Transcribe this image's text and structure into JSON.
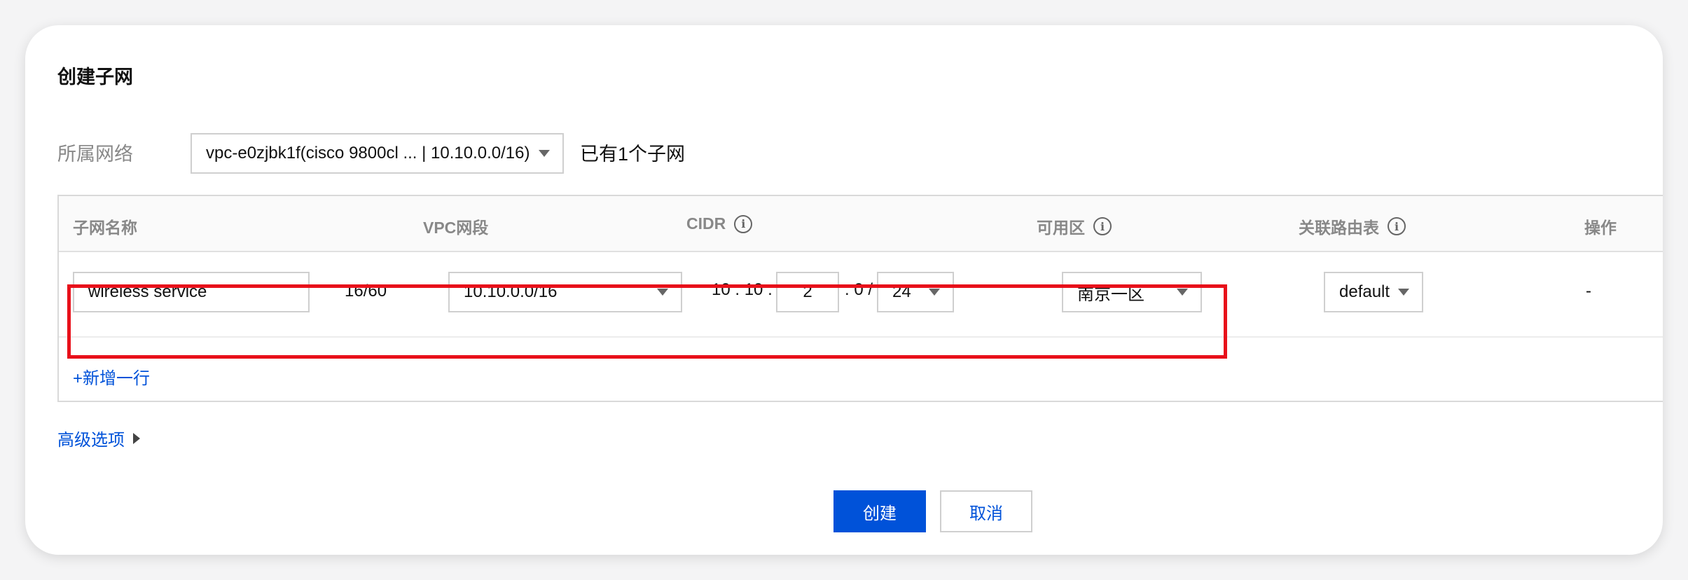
{
  "dialog": {
    "title": "创建子网"
  },
  "network": {
    "label": "所属网络",
    "selected": "vpc-e0zjbk1f(cisco 9800cl ... | 10.10.0.0/16)",
    "note": "已有1个子网"
  },
  "table": {
    "headers": {
      "name": "子网名称",
      "vpc": "VPC网段",
      "cidr": "CIDR",
      "zone": "可用区",
      "route": "关联路由表",
      "action": "操作"
    },
    "row": {
      "name_value": "wireless service",
      "name_count": "16/60",
      "vpc_value": "10.10.0.0/16",
      "cidr_prefix": "10 . 10 .",
      "cidr_octet": "2",
      "cidr_mid": ". 0 /",
      "cidr_mask": "24",
      "zone_value": "南京一区",
      "route_value": "default",
      "action_value": "-"
    },
    "add_row_label": "+新增一行"
  },
  "advanced_label": "高级选项",
  "buttons": {
    "create": "创建",
    "cancel": "取消"
  },
  "colors": {
    "primary": "#0052d9",
    "highlight": "#e8101a"
  },
  "icons": [
    "info-icon",
    "dropdown-arrow-icon",
    "expand-triangle-icon"
  ]
}
